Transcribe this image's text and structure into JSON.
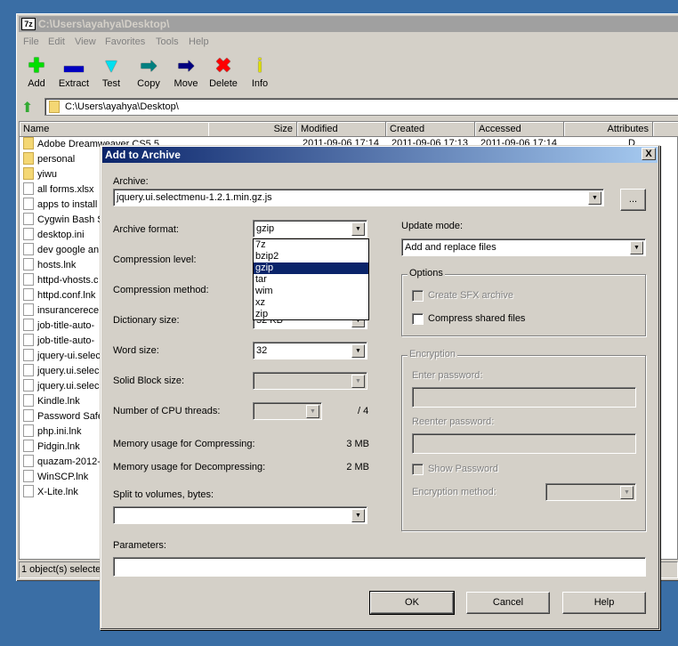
{
  "window": {
    "title": "C:\\Users\\ayahya\\Desktop\\",
    "logo": "7z"
  },
  "menu": [
    "File",
    "Edit",
    "View",
    "Favorites",
    "Tools",
    "Help"
  ],
  "toolbar": [
    {
      "label": "Add",
      "icon": "plus-icon",
      "glyph": "✚",
      "color": "#00e000"
    },
    {
      "label": "Extract",
      "icon": "minus-icon",
      "glyph": "▬",
      "color": "#0000c0"
    },
    {
      "label": "Test",
      "icon": "check-chevron-icon",
      "glyph": "▼",
      "color": "#00e0f0"
    },
    {
      "label": "Copy",
      "icon": "copy-arrow-icon",
      "glyph": "➡",
      "color": "#008080"
    },
    {
      "label": "Move",
      "icon": "move-arrow-icon",
      "glyph": "➡",
      "color": "#000080"
    },
    {
      "label": "Delete",
      "icon": "delete-x-icon",
      "glyph": "✖",
      "color": "#ff0000"
    },
    {
      "label": "Info",
      "icon": "info-icon",
      "glyph": "i",
      "color": "#e0e000"
    }
  ],
  "address": {
    "path": "C:\\Users\\ayahya\\Desktop\\"
  },
  "columns": [
    "Name",
    "Size",
    "Modified",
    "Created",
    "Accessed",
    "Attributes"
  ],
  "first_row": {
    "modified": "2011-09-06 17:14",
    "created": "2011-09-06 17:13",
    "accessed": "2011-09-06 17:14",
    "attributes": "D"
  },
  "files": [
    {
      "name": "Adobe Dreamweaver CS5.5",
      "type": "folder"
    },
    {
      "name": "personal",
      "type": "folder"
    },
    {
      "name": "yiwu",
      "type": "folder"
    },
    {
      "name": "all forms.xlsx",
      "type": "excel"
    },
    {
      "name": "apps to install",
      "type": "text"
    },
    {
      "name": "Cygwin Bash S",
      "type": "file"
    },
    {
      "name": "desktop.ini",
      "type": "settings"
    },
    {
      "name": "dev google an",
      "type": "text"
    },
    {
      "name": "hosts.lnk",
      "type": "file"
    },
    {
      "name": "httpd-vhosts.c",
      "type": "file"
    },
    {
      "name": "httpd.conf.lnk",
      "type": "file"
    },
    {
      "name": "insurancerece",
      "type": "image"
    },
    {
      "name": "job-title-auto-",
      "type": "text"
    },
    {
      "name": "job-title-auto-",
      "type": "text"
    },
    {
      "name": "jquery-ui.selec",
      "type": "text"
    },
    {
      "name": "jquery.ui.selec",
      "type": "text"
    },
    {
      "name": "jquery.ui.selec",
      "type": "text"
    },
    {
      "name": "Kindle.lnk",
      "type": "file"
    },
    {
      "name": "Password Safe",
      "type": "file"
    },
    {
      "name": "php.ini.lnk",
      "type": "file"
    },
    {
      "name": "Pidgin.lnk",
      "type": "file"
    },
    {
      "name": "quazam-2012-",
      "type": "text"
    },
    {
      "name": "WinSCP.lnk",
      "type": "file"
    },
    {
      "name": "X-Lite.lnk",
      "type": "file"
    }
  ],
  "status": "1 object(s) selected",
  "dialog": {
    "title": "Add to Archive",
    "close": "X",
    "archive_label": "Archive:",
    "archive_value": "jquery.ui.selectmenu-1.2.1.min.gz.js",
    "browse": "...",
    "format_label": "Archive format:",
    "format_value": "gzip",
    "format_options": [
      "7z",
      "bzip2",
      "gzip",
      "tar",
      "wim",
      "xz",
      "zip"
    ],
    "level_label": "Compression level:",
    "method_label": "Compression method:",
    "dict_label": "Dictionary size:",
    "dict_value": "32 KB",
    "word_label": "Word size:",
    "word_value": "32",
    "solid_label": "Solid Block size:",
    "cpu_label": "Number of CPU threads:",
    "cpu_total": "/ 4",
    "mem_comp_label": "Memory usage for Compressing:",
    "mem_comp_value": "3 MB",
    "mem_decomp_label": "Memory usage for Decompressing:",
    "mem_decomp_value": "2 MB",
    "split_label": "Split to volumes, bytes:",
    "update_label": "Update mode:",
    "update_value": "Add and replace files",
    "options_label": "Options",
    "sfx_label": "Create SFX archive",
    "shared_label": "Compress shared files",
    "enc_label": "Encryption",
    "pw_label": "Enter password:",
    "repw_label": "Reenter password:",
    "show_pw_label": "Show Password",
    "enc_method_label": "Encryption method:",
    "params_label": "Parameters:",
    "ok": "OK",
    "cancel": "Cancel",
    "help": "Help"
  }
}
